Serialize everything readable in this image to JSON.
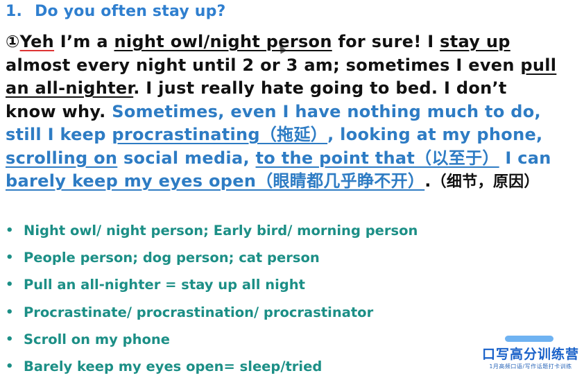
{
  "question": {
    "number": "1.",
    "text": "Do you often stay up?"
  },
  "answer": {
    "p01": "①",
    "p02": "Yeh",
    "p03": " I’m a ",
    "p04": "night owl/night person",
    "p05": " for sure! I ",
    "p06": "stay up",
    "p07": " almost every night until 2 or 3 am; sometimes I even ",
    "p08": "pull an all-nighter",
    "p09": ". I just really hate going to bed. I don’t know why. ",
    "p10": "Sometimes, even I have nothing much to do, still I keep ",
    "p11": "procrastinating（拖延）",
    "p12": ", looking at my phone, ",
    "p13": "scrolling on",
    "p14": " social media, ",
    "p15": "to the point that（以至于）",
    "p16": " I can ",
    "p17": "barely keep my eyes open（眼睛都几乎睁不开）",
    "p18": ".",
    "p19": "（细节，原因）"
  },
  "bullets": [
    {
      "marker": "•",
      "text": "Night owl/ night person; Early bird/ morning person"
    },
    {
      "marker": "•",
      "text": "People person; dog person; cat person"
    },
    {
      "marker": "•",
      "text": "Pull an all-nighter = stay up all night"
    },
    {
      "marker": "•",
      "text": "Procrastinate/ procrastination/ procrastinator"
    },
    {
      "marker": "•",
      "text": "Scroll on my phone"
    },
    {
      "marker": "•",
      "text": "Barely keep my eyes open= sleep/tried"
    }
  ],
  "badge": {
    "main": "口写高分训练营",
    "sub": "1月高频口语/写作话题打卡训练"
  },
  "colors": {
    "title": "#2f7fcf",
    "blue_text": "#2e7cc4",
    "bullet_text": "#1c8f86",
    "badge": "#1a62c9"
  }
}
